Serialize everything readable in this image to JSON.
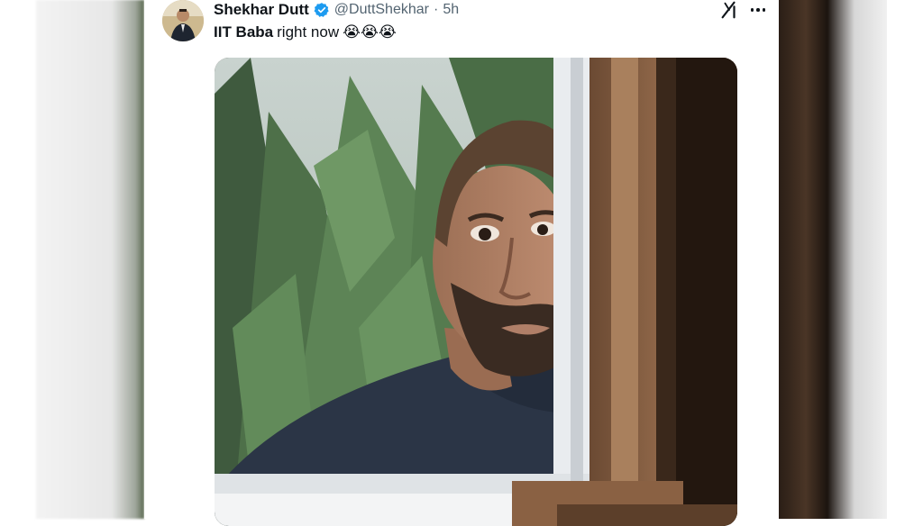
{
  "tweet": {
    "author_name": "Shekhar Dutt",
    "handle": "@DuttShekhar",
    "separator": "·",
    "time": "5h",
    "text_bold": "IIT Baba",
    "text_rest": "right now",
    "emojis": "😭😭😭",
    "verified_icon": "verified-badge-icon",
    "more_icon": "more-options-icon",
    "logo_icon": "grok-logo-icon"
  },
  "colors": {
    "text_primary": "#0f1419",
    "text_secondary": "#536471",
    "verified_blue": "#1d9bf0"
  }
}
